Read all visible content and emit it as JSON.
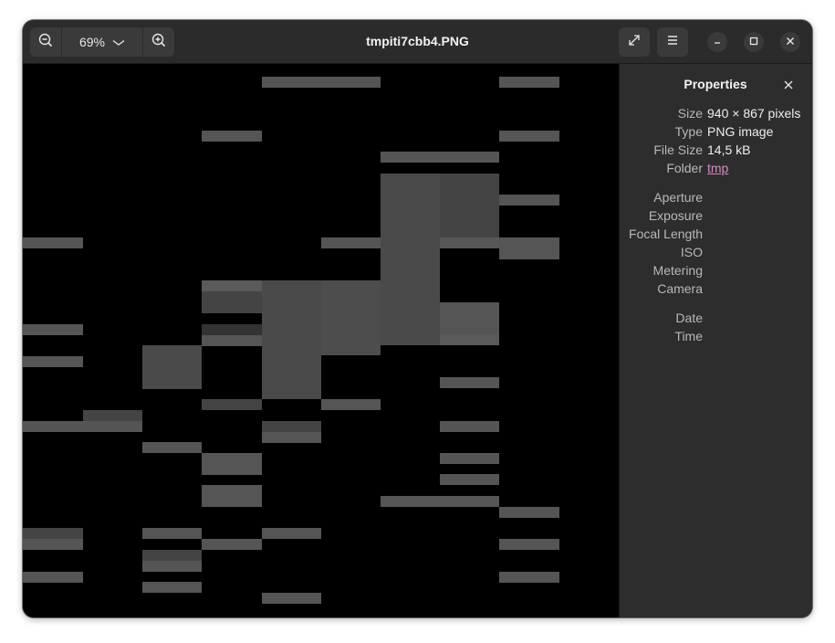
{
  "window": {
    "title": "tmpiti7cbb4.PNG"
  },
  "toolbar": {
    "zoom_out_icon": "zoom-out-icon",
    "zoom_level": "69%",
    "zoom_in_icon": "zoom-in-icon",
    "fullscreen_icon": "fullscreen-icon",
    "menu_icon": "hamburger-menu-icon",
    "minimize_icon": "minimize-icon",
    "maximize_icon": "maximize-icon",
    "close_icon": "close-icon"
  },
  "properties": {
    "title": "Properties",
    "rows": [
      {
        "label": "Size",
        "value": "940 × 867 pixels"
      },
      {
        "label": "Type",
        "value": "PNG image"
      },
      {
        "label": "File Size",
        "value": "14,5 kB"
      },
      {
        "label": "Folder",
        "value": "tmp"
      },
      {
        "label": "Aperture",
        "value": ""
      },
      {
        "label": "Exposure",
        "value": ""
      },
      {
        "label": "Focal Length",
        "value": ""
      },
      {
        "label": "ISO",
        "value": ""
      },
      {
        "label": "Metering",
        "value": ""
      },
      {
        "label": "Camera",
        "value": ""
      },
      {
        "label": "Date",
        "value": ""
      },
      {
        "label": "Time",
        "value": ""
      }
    ]
  },
  "colors": {
    "accent_link": "#d68bbf",
    "canvas_bg": "#000000",
    "cell_gray": "#595959"
  }
}
